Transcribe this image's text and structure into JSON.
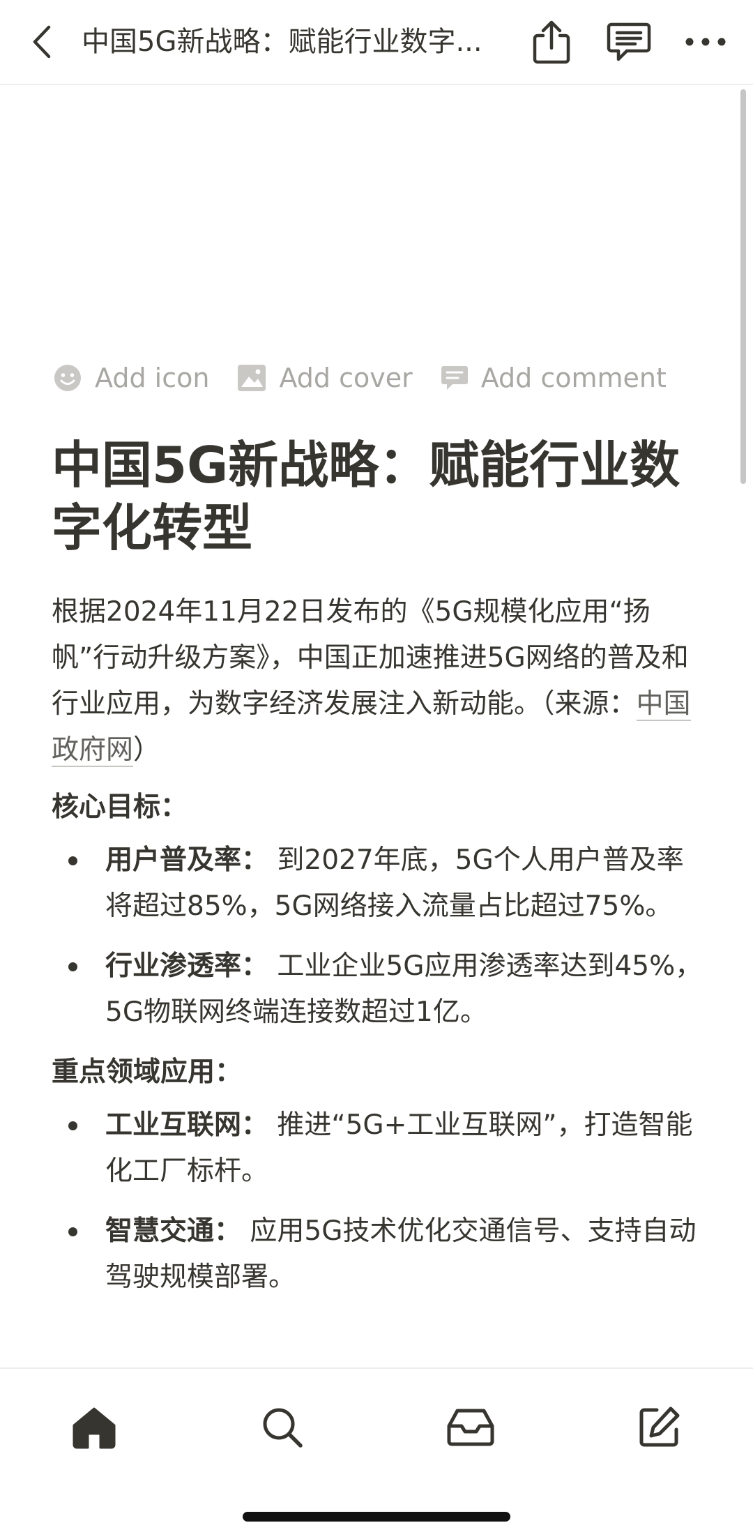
{
  "topbar": {
    "title": "中国5G新战略：赋能行业数字..."
  },
  "page_actions": {
    "add_icon": "Add icon",
    "add_cover": "Add cover",
    "add_comment": "Add comment"
  },
  "document": {
    "title": "中国5G新战略：赋能行业数字化转型",
    "intro_text": "根据2024年11月22日发布的《5G规模化应用“扬帆”行动升级方案》，中国正加速推进5G网络的普及和行业应用，为数字经济发展注入新动能。（来源：",
    "source_link": "中国政府网",
    "intro_close": "）",
    "sections": [
      {
        "heading": "核心目标：",
        "items": [
          {
            "label": "用户普及率：",
            "text": " 到2027年底，5G个人用户普及率将超过85%，5G网络接入流量占比超过75%。"
          },
          {
            "label": "行业渗透率：",
            "text": " 工业企业5G应用渗透率达到45%，5G物联网终端连接数超过1亿。"
          }
        ]
      },
      {
        "heading": "重点领域应用：",
        "items": [
          {
            "label": "工业互联网：",
            "text": " 推进“5G+工业互联网”，打造智能化工厂标杆。"
          },
          {
            "label": "智慧交通：",
            "text": " 应用5G技术优化交通信号、支持自动驾驶规模部署。"
          }
        ]
      }
    ]
  },
  "icons": {
    "back": "chevron-left-icon",
    "share": "share-icon",
    "comments": "comment-icon",
    "more": "more-horizontal-icon",
    "home": "home-icon",
    "search": "search-icon",
    "inbox": "inbox-icon",
    "new_page": "compose-icon"
  },
  "colors": {
    "text": "#37352f",
    "muted": "#a8a7a3",
    "link": "#62615d"
  }
}
